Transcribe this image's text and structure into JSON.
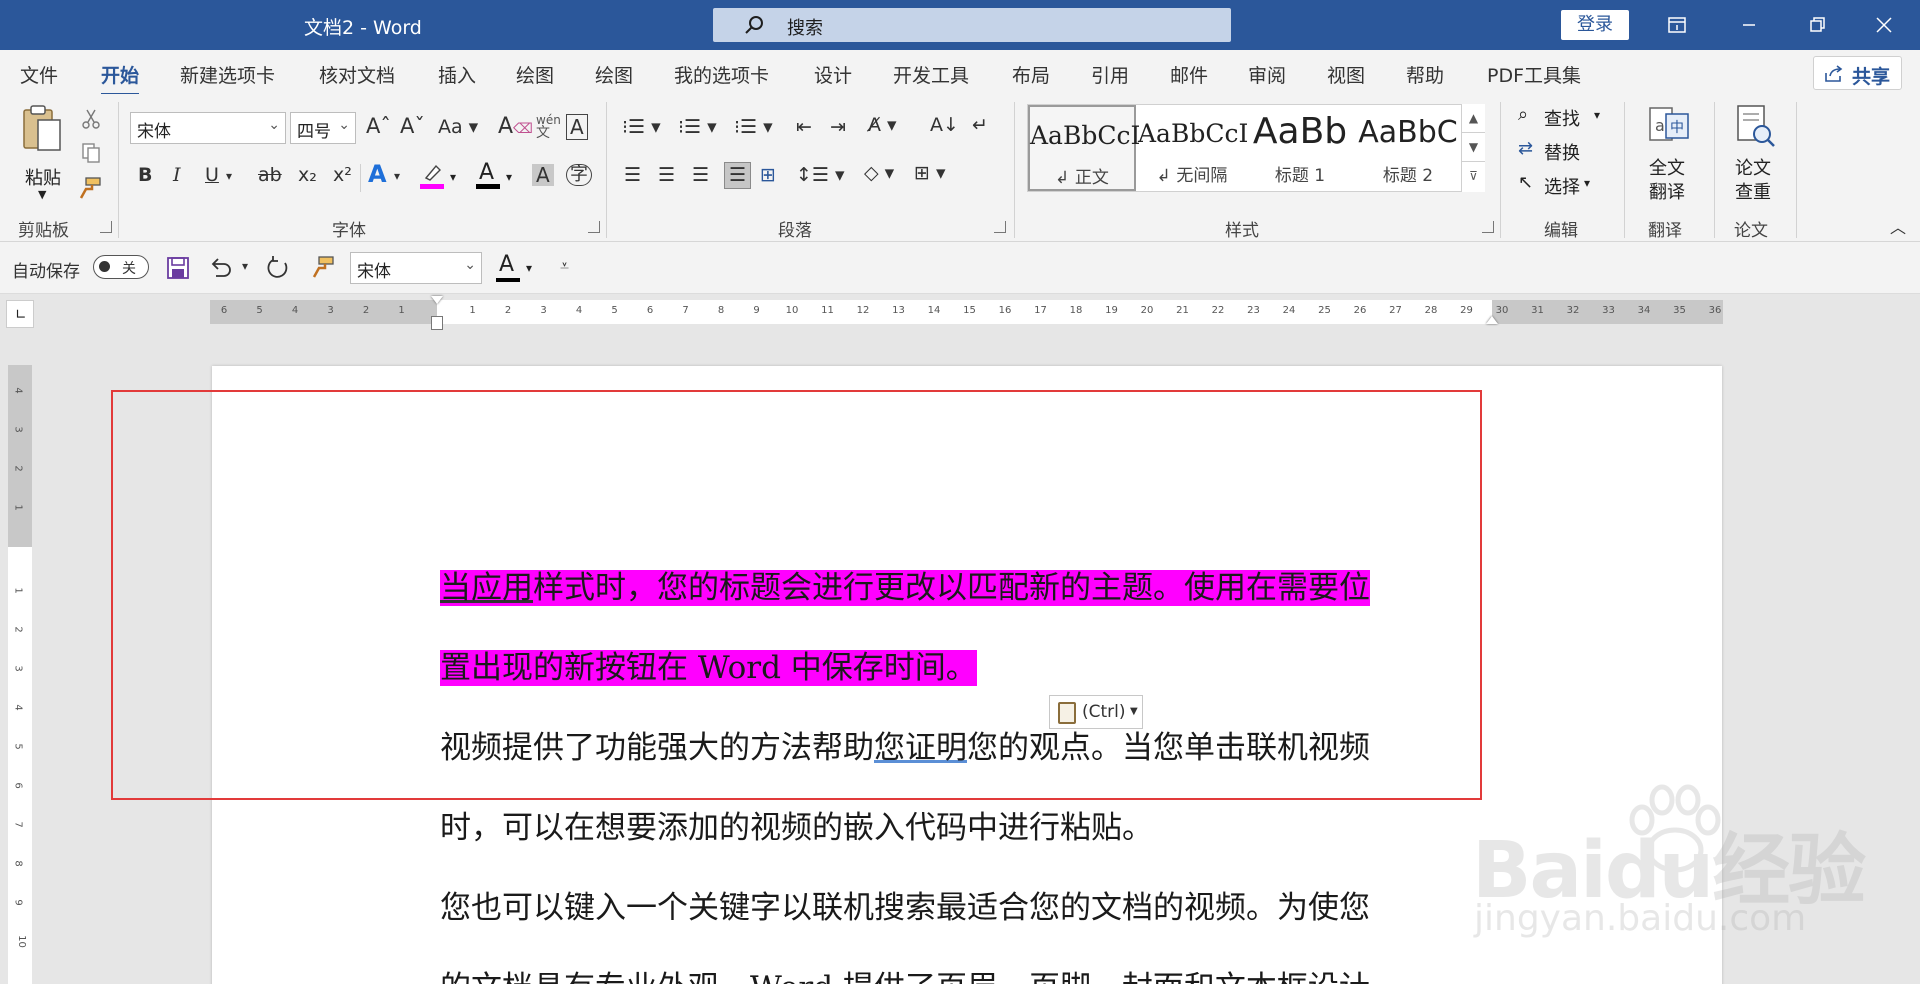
{
  "window": {
    "title": "文档2  -  Word",
    "search_placeholder": "搜索",
    "login_label": "登录"
  },
  "menu": {
    "tabs": [
      "文件",
      "开始",
      "新建选项卡",
      "核对文档",
      "插入",
      "绘图",
      "绘图",
      "我的选项卡",
      "设计",
      "开发工具",
      "布局",
      "引用",
      "邮件",
      "审阅",
      "视图",
      "帮助",
      "PDF工具集"
    ],
    "active_tab": "开始",
    "share_label": "共享"
  },
  "ribbon": {
    "clipboard": {
      "paste_label": "粘贴",
      "group_label": "剪贴板"
    },
    "font": {
      "font_name": "宋体",
      "font_size": "四号",
      "group_label": "字体",
      "buttons": {
        "bold": "B",
        "italic": "I",
        "underline": "U",
        "strike": "ab",
        "subscript": "x₂",
        "superscript": "x²",
        "grow": "A^",
        "shrink": "Aˇ",
        "case": "Aa",
        "phonetic_top": "wén",
        "phonetic_bottom": "文"
      }
    },
    "paragraph": {
      "group_label": "段落"
    },
    "styles": {
      "group_label": "样式",
      "items": [
        {
          "sample": "AaBbCcI",
          "name": "↲ 正文"
        },
        {
          "sample": "AaBbCcI",
          "name": "↲ 无间隔"
        },
        {
          "sample": "AaBb",
          "name": "标题 1"
        },
        {
          "sample": "AaBbC",
          "name": "标题 2"
        }
      ]
    },
    "editing": {
      "find": "查找",
      "replace": "替换",
      "select": "选择",
      "group_label": "编辑"
    },
    "translate": {
      "label_line1": "全文",
      "label_line2": "翻译",
      "group_label": "翻译"
    },
    "paper": {
      "label_line1": "论文",
      "label_line2": "查重",
      "group_label": "论文"
    }
  },
  "quick_access": {
    "autosave_label": "自动保存",
    "autosave_state": "关",
    "font_name": "宋体"
  },
  "ruler": {
    "h_labels_left": [
      "6",
      "5",
      "4",
      "3",
      "2",
      "1"
    ],
    "h_labels_right": [
      "1",
      "2",
      "3",
      "4",
      "5",
      "6",
      "7",
      "8",
      "9",
      "10",
      "11",
      "12",
      "13",
      "14",
      "15",
      "16",
      "17",
      "18",
      "19",
      "20",
      "21",
      "22",
      "23",
      "24",
      "25",
      "26",
      "27",
      "28",
      "29",
      "30",
      "31",
      "32",
      "33",
      "34",
      "35",
      "36"
    ],
    "v_labels_top": [
      "4",
      "3",
      "2",
      "1"
    ],
    "v_labels_body": [
      "1",
      "2",
      "3",
      "4",
      "5",
      "6",
      "7",
      "8",
      "9",
      "10"
    ]
  },
  "document": {
    "para1_line1_ul": "当应用",
    "para1_line1_rest": "样式时，您的标题会进行更改以匹配新的主题。使用在需要位",
    "para1_line2": "置出现的新按钮在 Word 中保存时间。",
    "para2_line1_a": "视频提供了功能强大的方法帮助",
    "para2_line1_ul": "您证明",
    "para2_line1_b": "您的观点。当您单击联机视频",
    "para2_line2": "时，可以在想要添加的视频的嵌入代码中进行粘贴。",
    "para3_line1": "您也可以键入一个关键字以联机搜索最适合您的文档的视频。为使您",
    "para3_line2": "的文档具有专业外观，Word 提供了页眉、页脚、封面和文本框设计"
  },
  "paste_options_label": "(Ctrl)",
  "watermark": {
    "brand": "Baidu经验",
    "site": "jingyan.baidu.com"
  },
  "colors": {
    "title_bar": "#2b579a",
    "highlight": "#ff00ff",
    "annotation_box": "#e23a3a"
  }
}
